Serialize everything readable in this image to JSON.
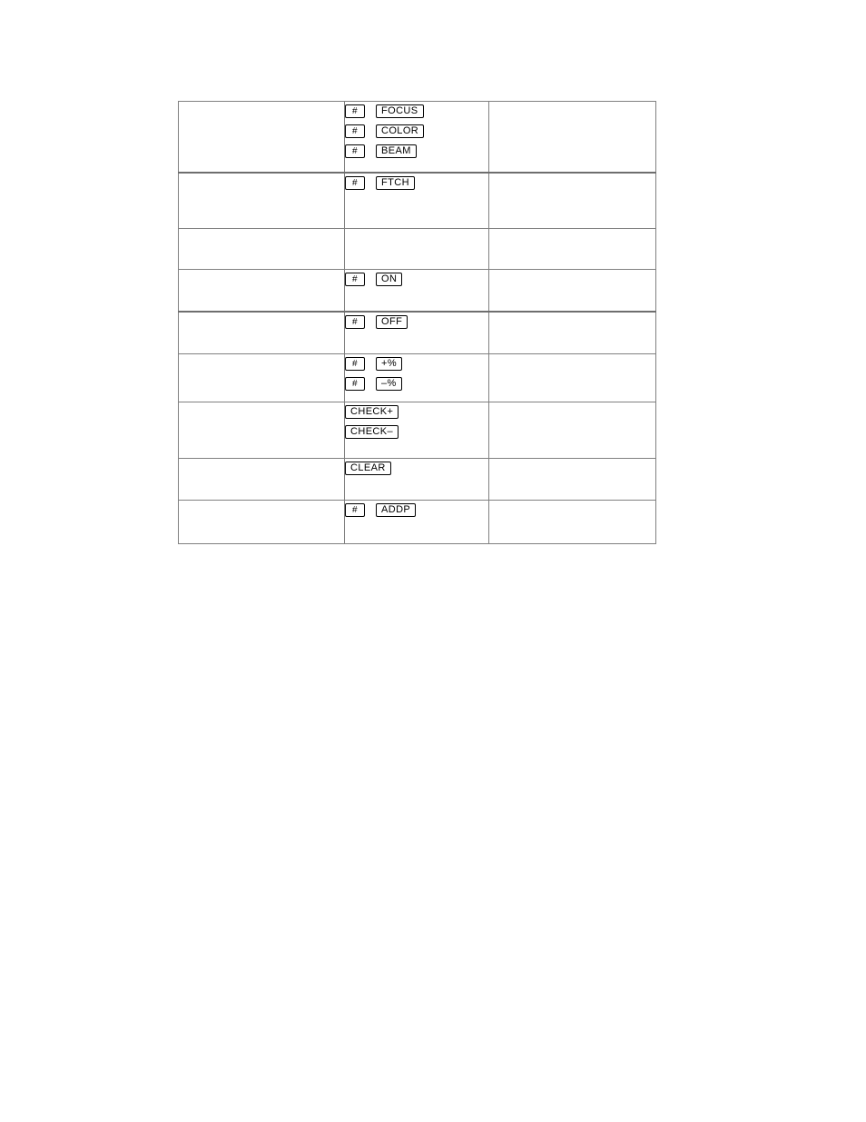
{
  "page": {
    "background_color": "#ffffff",
    "table_border_color": "#808080",
    "key_border_color": "#000000"
  },
  "table": {
    "name": "key-reference-table",
    "column_count": 3,
    "row_count": 9,
    "columns": [
      {
        "id": "description",
        "label": ""
      },
      {
        "id": "keys",
        "label": ""
      },
      {
        "id": "notes",
        "label": ""
      }
    ],
    "rows": [
      {
        "description": "",
        "notes": "",
        "keys": [
          {
            "hash": "#",
            "label": "FOCUS"
          },
          {
            "hash": "#",
            "label": "COLOR"
          },
          {
            "hash": "#",
            "label": "BEAM"
          }
        ]
      },
      {
        "description": "",
        "notes": "",
        "keys": [
          {
            "hash": "#",
            "label": "FTCH"
          }
        ]
      },
      {
        "description": "",
        "notes": "",
        "keys": []
      },
      {
        "description": "",
        "notes": "",
        "keys": [
          {
            "hash": "#",
            "label": "ON"
          }
        ]
      },
      {
        "description": "",
        "notes": "",
        "keys": [
          {
            "hash": "#",
            "label": "OFF"
          }
        ]
      },
      {
        "description": "",
        "notes": "",
        "keys": [
          {
            "hash": "#",
            "label": "+%"
          },
          {
            "hash": "#",
            "label": "–%"
          }
        ]
      },
      {
        "description": "",
        "notes": "",
        "keys": [
          {
            "hash": "",
            "label": "CHECK+"
          },
          {
            "hash": "",
            "label": "CHECK–"
          }
        ]
      },
      {
        "description": "",
        "notes": "",
        "keys": [
          {
            "hash": "",
            "label": "CLEAR"
          }
        ]
      },
      {
        "description": "",
        "notes": "",
        "keys": [
          {
            "hash": "#",
            "label": "ADDP"
          }
        ]
      }
    ]
  }
}
